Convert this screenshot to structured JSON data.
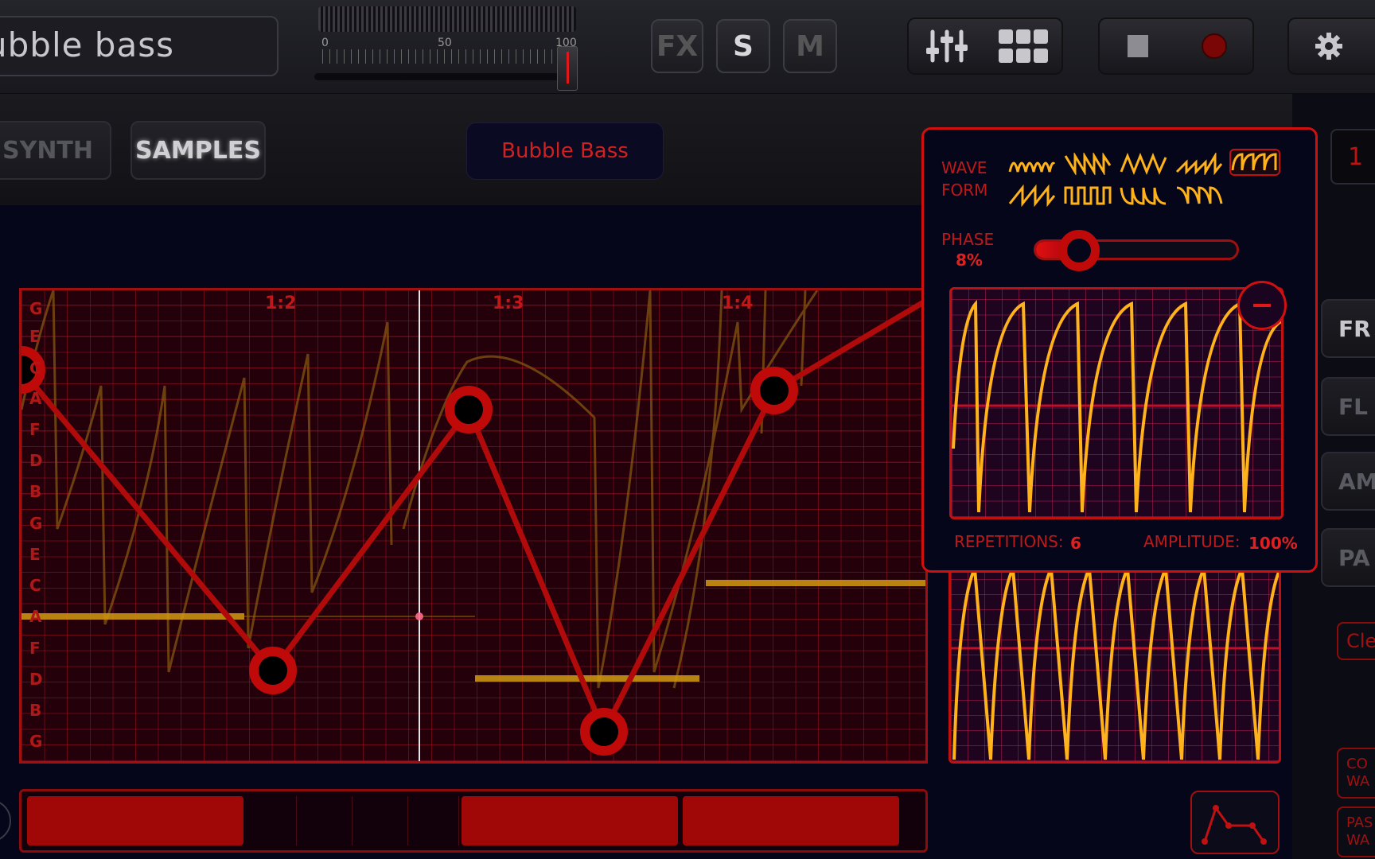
{
  "app": {
    "instrument_title": "ubble bass",
    "volume": {
      "scale": [
        "0",
        "50",
        "100"
      ],
      "value_percent": 100
    }
  },
  "toolbar": {
    "fx_label": "FX",
    "solo_label": "S",
    "mute_label": "M",
    "mixer_icon": "sliders-icon",
    "grid_icon": "grid-icon",
    "stop_icon": "stop-icon",
    "record_icon": "record-icon",
    "settings_icon": "gear-icon"
  },
  "modes": {
    "synth_label": "SYNTH",
    "samples_label": "SAMPLES",
    "active": "SAMPLES"
  },
  "preset": {
    "name": "Bubble Bass"
  },
  "editor": {
    "note_labels": [
      "G",
      "E",
      "C",
      "A",
      "F",
      "D",
      "B",
      "G",
      "E",
      "C",
      "A",
      "F",
      "D",
      "B",
      "G"
    ],
    "bar_labels": [
      "1:2",
      "1:3",
      "1:4"
    ],
    "sequence_steps": [
      true,
      false,
      false,
      false,
      false,
      true,
      true,
      false,
      false,
      false,
      false,
      false,
      false,
      false
    ]
  },
  "wave_popup": {
    "waveform_label_line1": "WAVE",
    "waveform_label_line2": "FORM",
    "waveform_options": [
      "sine-wave-icon",
      "ramp-down-wave-icon",
      "triangle-wave-icon",
      "ramp-up-wave-icon",
      "arc-wave-icon",
      "sawtooth-wave-icon",
      "square-wave-icon",
      "exp-wave-icon",
      "bump-wave-icon"
    ],
    "selected_waveform": "arc-wave-icon",
    "phase_label": "PHASE",
    "phase_value": "8%",
    "phase_fraction": 0.08,
    "repetitions_label": "REPETITIONS:",
    "repetitions_value": "6",
    "amplitude_label": "AMPLITUDE:",
    "amplitude_value": "100%",
    "remove_icon": "minus-icon"
  },
  "right_panel": {
    "tabs": [
      "FR",
      "FL",
      "AM",
      "PA"
    ],
    "active_tab": "FR",
    "number_value": "1",
    "clear_label": "Cle",
    "copy_label_lines": [
      "CO",
      "WA"
    ],
    "paste_label_lines": [
      "PAS",
      "WA"
    ],
    "envelope_icon": "envelope-icon"
  },
  "colors": {
    "accent_red": "#d01010",
    "wave_yellow": "#ffb21a",
    "background": "#06061a"
  }
}
